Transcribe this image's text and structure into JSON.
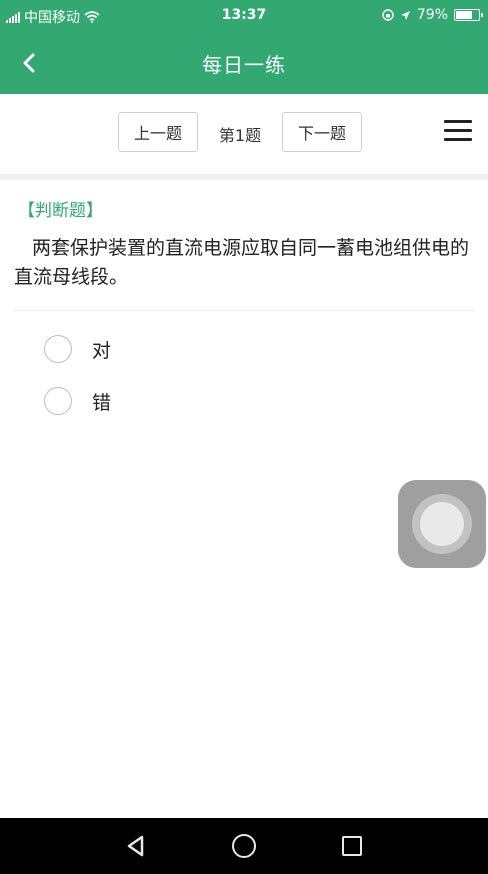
{
  "status_bar": {
    "carrier": "中国移动",
    "time": "13:37",
    "battery_percent": "79%",
    "battery_level": 0.79
  },
  "header": {
    "title": "每日一练",
    "back_icon": "chevron-left-icon"
  },
  "toolbar": {
    "prev_label": "上一题",
    "question_number": "第1题",
    "next_label": "下一题",
    "menu_icon": "hamburger-menu-icon"
  },
  "question": {
    "type_label": "【判断题】",
    "text": "两套保护装置的直流电源应取自同一蓄电池组供电的直流母线段。",
    "options": [
      {
        "label": "对",
        "selected": false
      },
      {
        "label": "错",
        "selected": false
      }
    ]
  },
  "colors": {
    "brand_green": "#34a873",
    "nav_bar": "#000000"
  }
}
